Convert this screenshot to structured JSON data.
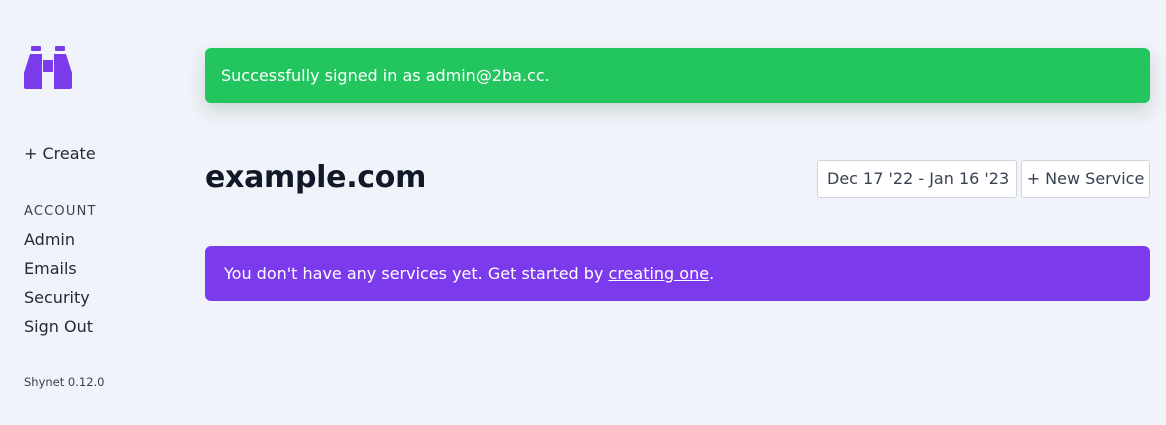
{
  "colors": {
    "accent": "#7c3aed",
    "success": "#22c55e",
    "background": "#f0f3f9"
  },
  "sidebar": {
    "logo_icon": "binoculars-icon",
    "create_label": "+ Create",
    "account_heading": "ACCOUNT",
    "items": [
      {
        "label": "Admin"
      },
      {
        "label": "Emails"
      },
      {
        "label": "Security"
      },
      {
        "label": "Sign Out"
      }
    ],
    "version": "Shynet 0.12.0"
  },
  "alerts": {
    "success": "Successfully signed in as admin@2ba.cc.",
    "info_prefix": "You don't have any services yet. Get started by ",
    "info_link": "creating one",
    "info_suffix": "."
  },
  "header": {
    "title": "example.com",
    "date_range": "Dec 17 '22 - Jan 16 '23",
    "new_service_label": "+ New Service"
  }
}
